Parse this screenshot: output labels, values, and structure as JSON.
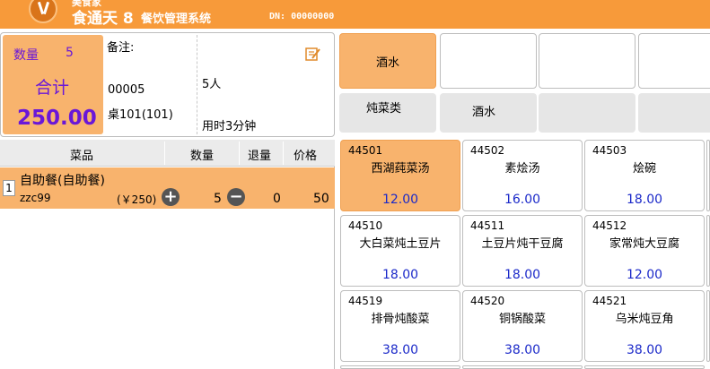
{
  "header": {
    "brand_small": "美食家",
    "app_title": "食通天 8",
    "app_subtitle": "餐饮管理系统",
    "device_label": "DN: 00000000"
  },
  "summary": {
    "qty_label": "数量",
    "qty_value": "5",
    "total_label": "合计",
    "total_value": "250.00",
    "note_label": "备注:",
    "order_no": "00005",
    "table_no": "桌101(101)",
    "people": "5人",
    "duration": "用时3分钟"
  },
  "categories": [
    {
      "label": "酒水",
      "active": true
    },
    {
      "label": "",
      "active": false
    },
    {
      "label": "",
      "active": false
    },
    {
      "label": "",
      "active": false
    }
  ],
  "subcategories": [
    {
      "label": "炖菜类"
    },
    {
      "label": "酒水"
    },
    {
      "label": ""
    },
    {
      "label": ""
    }
  ],
  "order_table": {
    "headers": {
      "name": "菜品",
      "qty": "数量",
      "returned": "退量",
      "price": "价格"
    },
    "rows": [
      {
        "index": "1",
        "name": "自助餐(自助餐)",
        "code": "zzc99",
        "unit_price": "(￥250)",
        "qty": "5",
        "returned": "0",
        "price": "50"
      }
    ]
  },
  "menu_items": [
    {
      "code": "44501",
      "name": "西湖莼菜汤",
      "price": "12.00",
      "selected": true
    },
    {
      "code": "44502",
      "name": "素烩汤",
      "price": "16.00"
    },
    {
      "code": "44503",
      "name": "烩碗",
      "price": "18.00"
    },
    {
      "code": "44510",
      "name": "大白菜炖土豆片",
      "price": "18.00"
    },
    {
      "code": "44511",
      "name": "土豆片炖干豆腐",
      "price": "18.00"
    },
    {
      "code": "44512",
      "name": "家常炖大豆腐",
      "price": "12.00"
    },
    {
      "code": "44519",
      "name": "排骨炖酸菜",
      "price": "38.00"
    },
    {
      "code": "44520",
      "name": "铜锅酸菜",
      "price": "38.00"
    },
    {
      "code": "44521",
      "name": "乌米炖豆角",
      "price": "38.00"
    }
  ],
  "colors": {
    "accent": "#f79a3a",
    "highlight": "#f8b36d",
    "price_blue": "#1b29c9",
    "summary_purple": "#6a17d8"
  }
}
